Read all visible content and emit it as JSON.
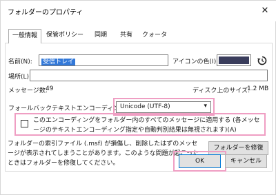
{
  "window": {
    "title": "フォルダーのプロパティ",
    "close_label": "✕"
  },
  "tabs": [
    {
      "label": "一般情報"
    },
    {
      "label": "保管ポリシー"
    },
    {
      "label": "同期"
    },
    {
      "label": "共有"
    },
    {
      "label": "クォータ"
    }
  ],
  "general": {
    "name_label": "名前(N):",
    "name_value": "受信トレイ",
    "icon_color_label": "アイコンの色(I):",
    "icon_color": "#3a3d5c",
    "location_label": "場所(L):",
    "location_value": "",
    "message_count_label": "メッセージ数:",
    "message_count": "49",
    "disk_size_label": "ディスク上のサイズ:",
    "disk_size": "1.2 MB",
    "fallback_encoding_label": "フォールバックテキストエンコーディング(E):",
    "fallback_encoding_value": "Unicode (UTF-8)",
    "apply_all_checkbox_text": "このエンコーディングをフォルダー内のすべてのメッセージに適用する (各メッセージのテキストエンコーディング指定や自動判別結果は無視されます)(A)",
    "index_info_text": "フォルダーの索引ファイル (.msf) が損傷し、削除したはずのメッセージが表示されてしまうことがあります。このような問題が起こったときはフォルダーを修復してください。",
    "repair_button_label": "フォルダーを修復(R)"
  },
  "footer": {
    "ok_label": "OK",
    "cancel_label": "キャンセル"
  },
  "colors": {
    "highlight": "#ef9ec3",
    "selection": "#3379d9"
  }
}
